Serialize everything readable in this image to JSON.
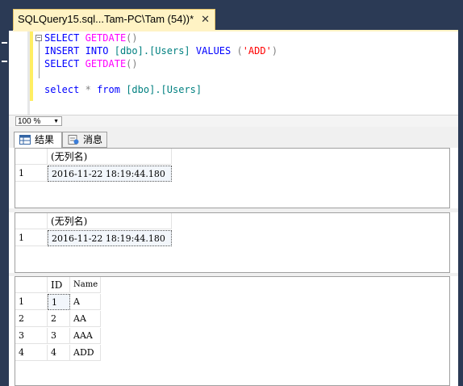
{
  "tab": {
    "title": "SQLQuery15.sql...Tam-PC\\Tam (54))*",
    "close_glyph": "✕"
  },
  "editor": {
    "line1": {
      "kw": "SELECT",
      "fn": "GETDATE",
      "punct": "()"
    },
    "line2": {
      "kw1": "INSERT",
      "kw2": "INTO",
      "table": "[dbo].[Users]",
      "kw3": "VALUES",
      "open": " (",
      "val": "'ADD'",
      "close": ")"
    },
    "line3": {
      "kw": "SELECT",
      "fn": "GETDATE",
      "punct": "()"
    },
    "line5": {
      "kw1": "select",
      "star": "*",
      "kw2": "from",
      "table": "[dbo].[Users]"
    }
  },
  "zoom": {
    "value": "100 %"
  },
  "result_tabs": [
    {
      "label": "结果"
    },
    {
      "label": "消息"
    }
  ],
  "grid1": {
    "header": "(无列名)",
    "rows": [
      {
        "num": "1",
        "value": "2016-11-22 18:19:44.180"
      }
    ]
  },
  "grid2": {
    "header": "(无列名)",
    "rows": [
      {
        "num": "1",
        "value": "2016-11-22 18:19:44.180"
      }
    ]
  },
  "grid3": {
    "headers": [
      "ID",
      "Name"
    ],
    "rows": [
      {
        "num": "1",
        "id": "1",
        "name": "A"
      },
      {
        "num": "2",
        "id": "2",
        "name": "AA"
      },
      {
        "num": "3",
        "id": "3",
        "name": "AAA"
      },
      {
        "num": "4",
        "id": "4",
        "name": "ADD"
      }
    ]
  },
  "colors": {
    "tab_bg": "#fff3c4",
    "frame": "#2b3a55",
    "keyword": "#0000ff",
    "function": "#ff00ff",
    "string": "#ff0000"
  }
}
